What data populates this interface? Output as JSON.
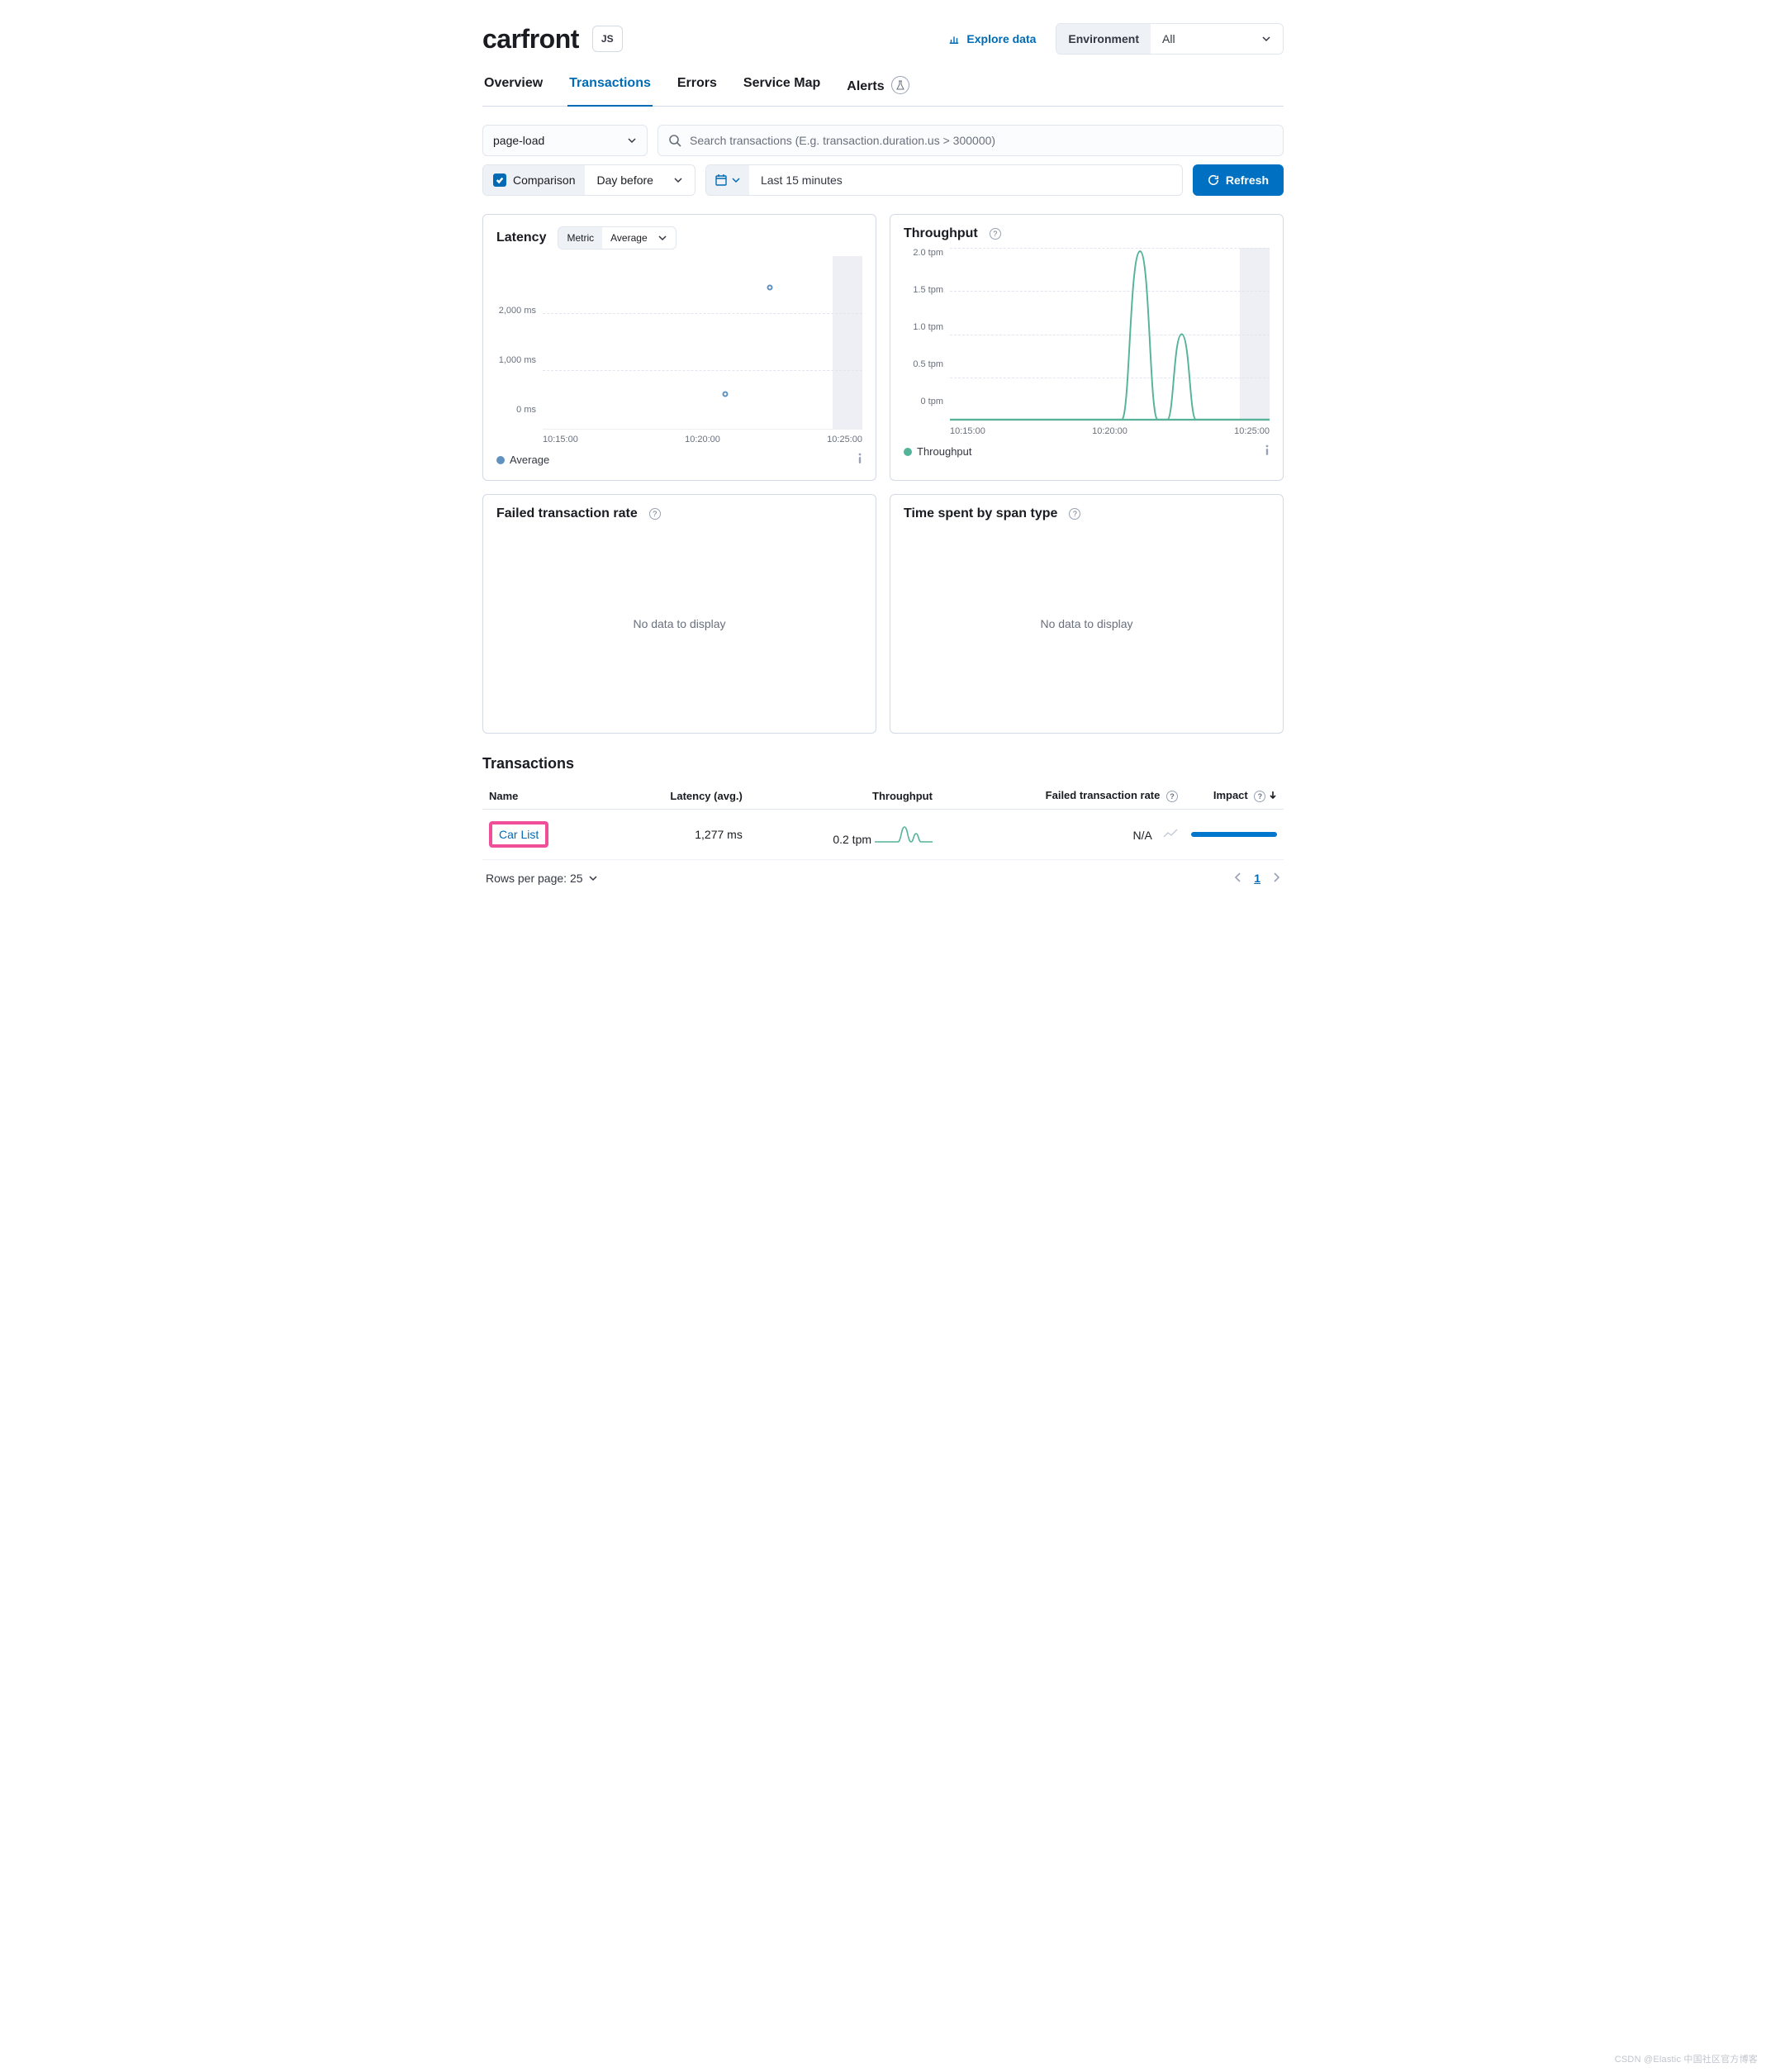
{
  "header": {
    "title": "carfront",
    "agent": "JS",
    "explore": "Explore data",
    "env_label": "Environment",
    "env_value": "All"
  },
  "tabs": {
    "overview": "Overview",
    "transactions": "Transactions",
    "errors": "Errors",
    "service_map": "Service Map",
    "alerts": "Alerts"
  },
  "filters": {
    "type_value": "page-load",
    "search_placeholder": "Search transactions (E.g. transaction.duration.us > 300000)",
    "comparison_label": "Comparison",
    "comparison_range": "Day before",
    "date_range": "Last 15 minutes",
    "refresh": "Refresh"
  },
  "panels": {
    "latency": {
      "title": "Latency",
      "metric_label": "Metric",
      "metric_value": "Average",
      "y_ticks": [
        "2,000 ms",
        "1,000 ms",
        "0 ms"
      ],
      "x_ticks": [
        "10:15:00",
        "10:20:00",
        "10:25:00"
      ],
      "legend": "Average"
    },
    "throughput": {
      "title": "Throughput",
      "y_ticks": [
        "2.0 tpm",
        "1.5 tpm",
        "1.0 tpm",
        "0.5 tpm",
        "0 tpm"
      ],
      "x_ticks": [
        "10:15:00",
        "10:20:00",
        "10:25:00"
      ],
      "legend": "Throughput"
    },
    "failed_rate": {
      "title": "Failed transaction rate",
      "nodata": "No data to display"
    },
    "span_time": {
      "title": "Time spent by span type",
      "nodata": "No data to display"
    }
  },
  "transactions_section": {
    "title": "Transactions",
    "columns": {
      "name": "Name",
      "latency": "Latency (avg.)",
      "throughput": "Throughput",
      "failed": "Failed transaction rate",
      "impact": "Impact"
    },
    "rows": [
      {
        "name": "Car List",
        "latency": "1,277 ms",
        "throughput": "0.2 tpm",
        "failed": "N/A"
      }
    ],
    "rows_per_page_label": "Rows per page: 25",
    "current_page": "1"
  },
  "watermark": "CSDN @Elastic 中国社区官方博客",
  "chart_data": [
    {
      "type": "scatter",
      "title": "Latency",
      "xlabel": "",
      "ylabel": "ms",
      "x_ticks": [
        "10:15:00",
        "10:20:00",
        "10:25:00"
      ],
      "ylim_ms": [
        0,
        2500
      ],
      "series": [
        {
          "name": "Average",
          "color": "#6092c0",
          "points": [
            {
              "x": "10:20:30",
              "y_ms": 500
            },
            {
              "x": "10:22:30",
              "y_ms": 2050
            }
          ]
        }
      ]
    },
    {
      "type": "line",
      "title": "Throughput",
      "xlabel": "",
      "ylabel": "tpm",
      "x_ticks": [
        "10:15:00",
        "10:20:00",
        "10:25:00"
      ],
      "ylim_tpm": [
        0,
        2.0
      ],
      "series": [
        {
          "name": "Throughput",
          "color": "#54b399",
          "points": [
            {
              "x": "10:12:00",
              "y_tpm": 0
            },
            {
              "x": "10:19:30",
              "y_tpm": 0
            },
            {
              "x": "10:20:30",
              "y_tpm": 2.0
            },
            {
              "x": "10:21:30",
              "y_tpm": 0
            },
            {
              "x": "10:22:30",
              "y_tpm": 0
            },
            {
              "x": "10:23:00",
              "y_tpm": 1.0
            },
            {
              "x": "10:23:30",
              "y_tpm": 0
            },
            {
              "x": "10:27:00",
              "y_tpm": 0
            }
          ]
        }
      ]
    }
  ]
}
